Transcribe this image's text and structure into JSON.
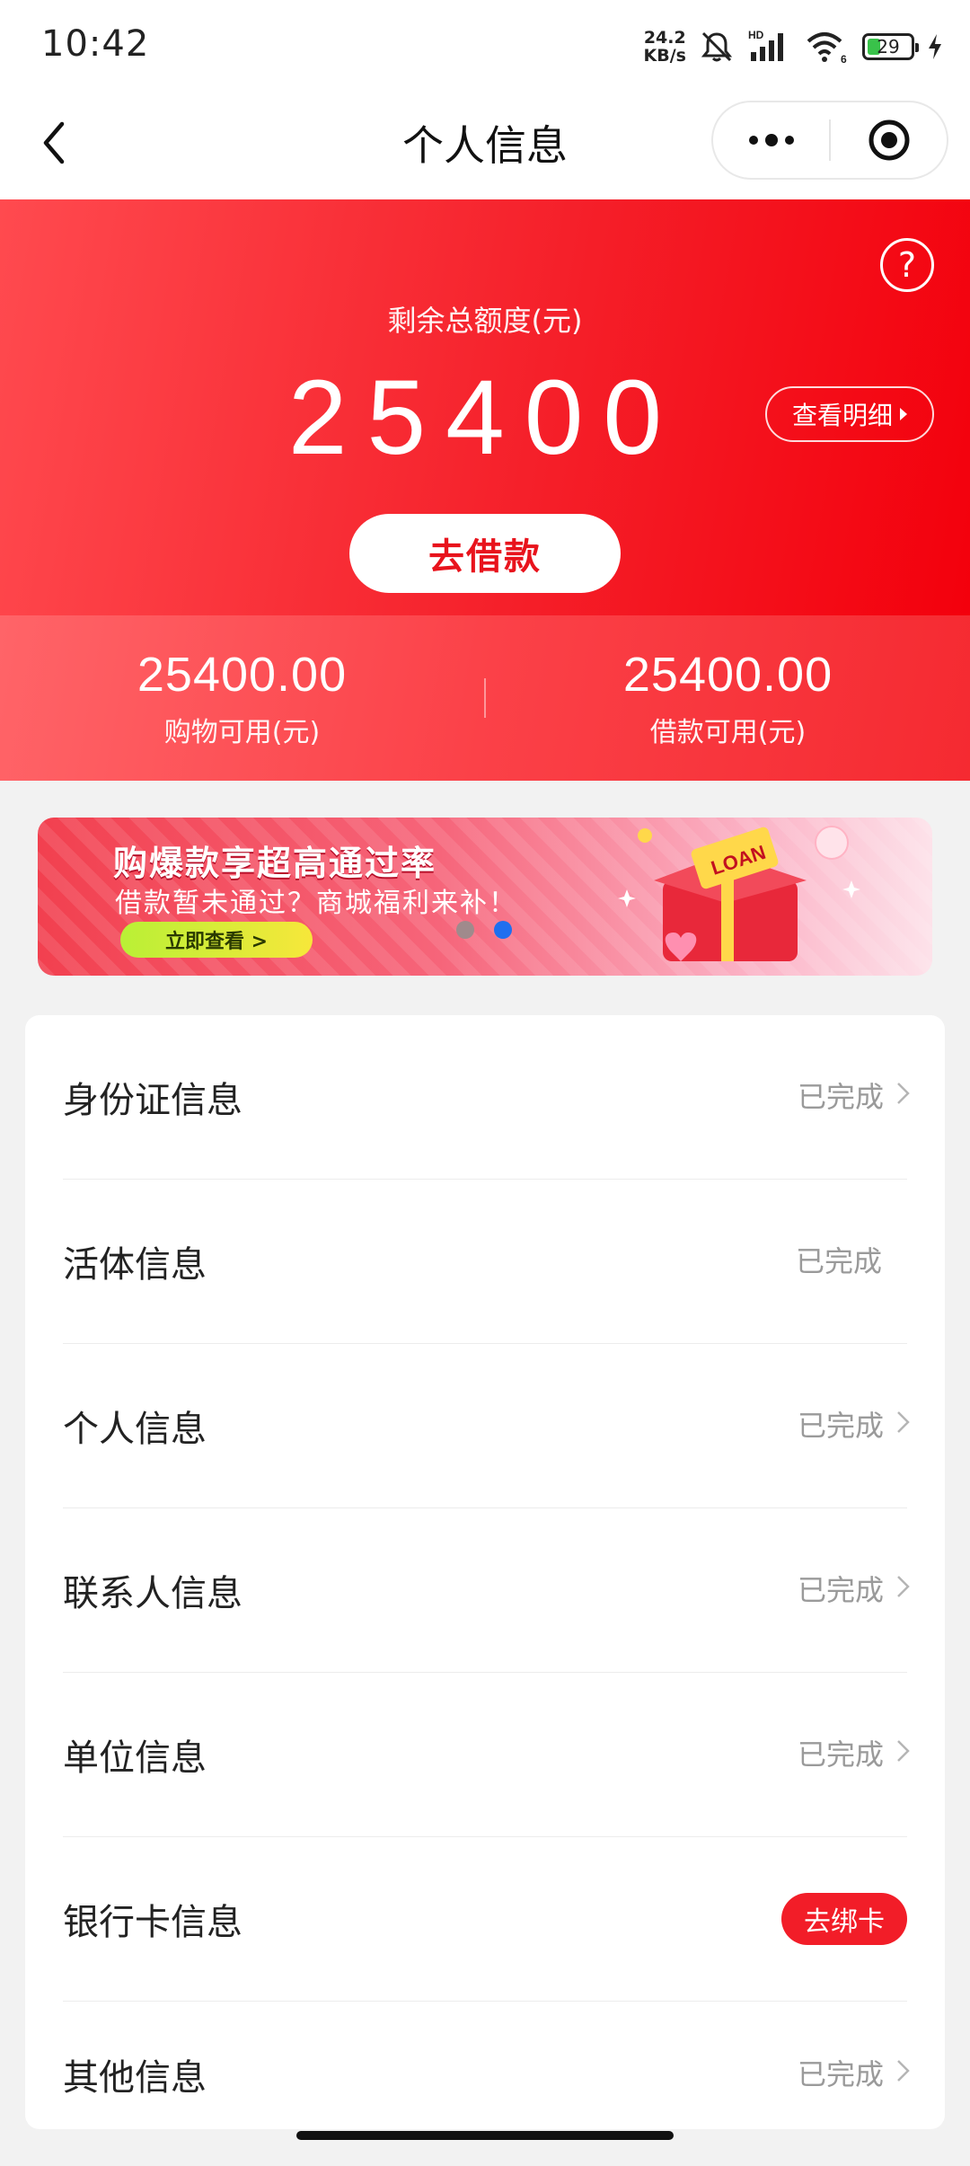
{
  "status_bar": {
    "time": "10:42",
    "net_speed_value": "24.2",
    "net_speed_unit": "KB/s",
    "signal_tag": "HD",
    "wifi_tag": "6",
    "battery": "29",
    "icons": [
      "mute-icon",
      "signal-icon",
      "wifi-icon",
      "battery-icon",
      "charging-icon"
    ]
  },
  "nav": {
    "title": "个人信息",
    "icons": [
      "back-icon",
      "more-icon",
      "close-target-icon"
    ]
  },
  "hero": {
    "label": "剩余总额度(元)",
    "amount": "25400",
    "detail_button": "查看明细",
    "borrow_button": "去借款",
    "help_glyph": "?",
    "colors": {
      "start": "#ff4a4f",
      "end": "#f3000c"
    }
  },
  "stats": [
    {
      "value": "25400.00",
      "label": "购物可用(元)"
    },
    {
      "value": "25400.00",
      "label": "借款可用(元)"
    }
  ],
  "banner": {
    "title": "购爆款享超高通过率",
    "subtitle": "借款暂未通过？商城福利来补！",
    "cta": "立即查看 >",
    "art_text": "LOAN",
    "page_count": 2,
    "active_page": 2
  },
  "list": [
    {
      "label": "身份证信息",
      "status": "已完成",
      "chevron": true
    },
    {
      "label": "活体信息",
      "status": "已完成",
      "chevron": false
    },
    {
      "label": "个人信息",
      "status": "已完成",
      "chevron": true
    },
    {
      "label": "联系人信息",
      "status": "已完成",
      "chevron": true
    },
    {
      "label": "单位信息",
      "status": "已完成",
      "chevron": true
    },
    {
      "label": "银行卡信息",
      "action": "去绑卡"
    },
    {
      "label": "其他信息",
      "status": "已完成",
      "chevron": true
    }
  ],
  "colors": {
    "accent": "#f21d28",
    "page_bg": "#f2f2f2",
    "muted_text": "#9a9a9a"
  }
}
